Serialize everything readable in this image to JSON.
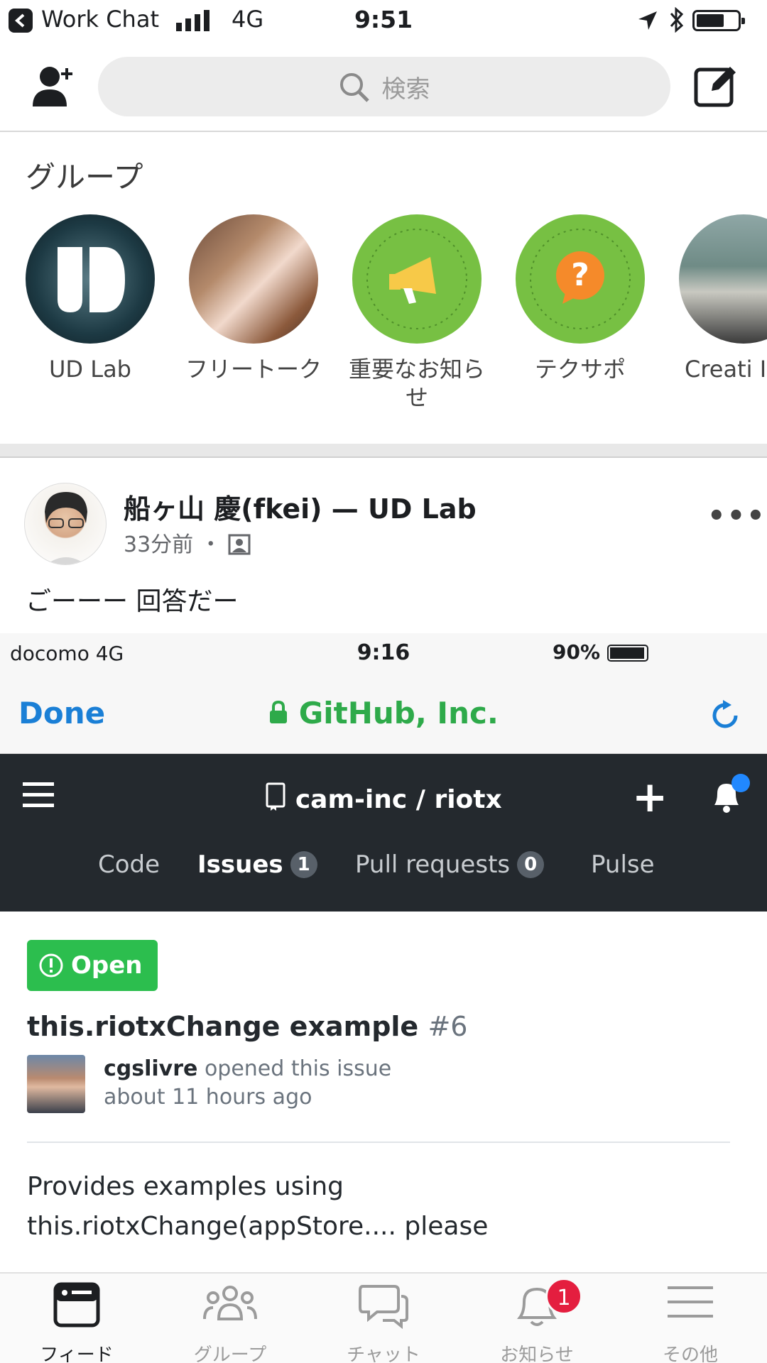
{
  "status_bar": {
    "back_app_label": "Work Chat",
    "network": "4G",
    "time": "9:51"
  },
  "search": {
    "placeholder": "検索"
  },
  "groups": {
    "title": "グループ",
    "items": [
      {
        "name": "UD Lab"
      },
      {
        "name": "フリートーク"
      },
      {
        "name": "重要なお知らせ"
      },
      {
        "name": "テクサポ"
      },
      {
        "name": "Creati Initiativ"
      }
    ]
  },
  "post": {
    "author": "船ヶ山 慶(fkei) — UD Lab",
    "time": "33分前 ・",
    "text": "ごーーー 回答だー",
    "more": "•••"
  },
  "screenshot": {
    "status": {
      "carrier": "docomo  4G",
      "time": "9:16",
      "battery": "90%"
    },
    "browser": {
      "done": "Done",
      "site": "GitHub, Inc."
    },
    "github": {
      "repo": "cam-inc / riotx",
      "tabs": [
        {
          "label": "Code"
        },
        {
          "label": "Issues",
          "count": "1"
        },
        {
          "label": "Pull requests",
          "count": "0"
        },
        {
          "label": "Pulse"
        }
      ],
      "badge": "Open",
      "issue_title": "this.riotxChange example",
      "issue_number": "#6",
      "issue_author": "cgslivre",
      "issue_action": "opened this issue",
      "issue_time": "about 11 hours ago",
      "body_line1": "Provides examples using",
      "body_line2": "this.riotxChange(appStore.... please"
    }
  },
  "tabbar": {
    "items": [
      {
        "label": "フィード"
      },
      {
        "label": "グループ"
      },
      {
        "label": "チャット"
      },
      {
        "label": "お知らせ",
        "badge": "1"
      },
      {
        "label": "その他"
      }
    ]
  }
}
